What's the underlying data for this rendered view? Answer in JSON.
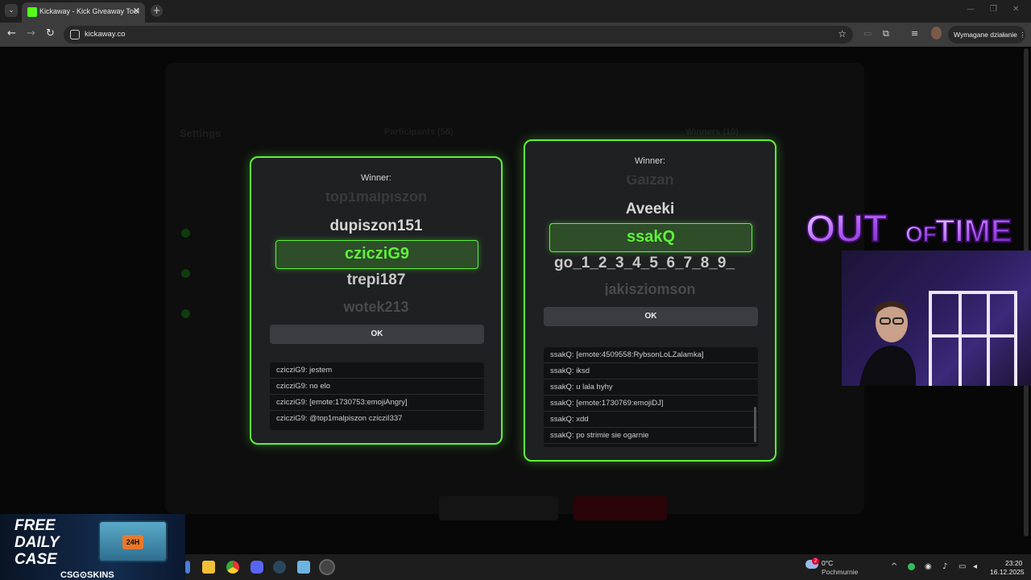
{
  "browser": {
    "tab_title": "Kickaway - Kick Giveaway Tool",
    "tab_menu_glyph": "⌄",
    "new_tab_glyph": "+",
    "url": "kickaway.co",
    "action_required_label": "Wymagane działanie",
    "accent_color": "#53fc18"
  },
  "modal_left": {
    "title": "Winner:",
    "reel": [
      "top1malpiszon",
      "dupiszon151",
      "trepi187",
      "wotek213"
    ],
    "winner": "czicziG9",
    "ok_label": "OK",
    "chat": [
      "czicziG9: jestem",
      "czicziG9: no elo",
      "czicziG9: [emote:1730753:emojiAngry]",
      "czicziG9: @top1malpiszon czicziI337"
    ]
  },
  "modal_right": {
    "title": "Winner:",
    "reel": [
      "Gaizan",
      "Aveeki",
      "go_1_2_3_4_5_6_7_8_9_",
      "jakisziomson"
    ],
    "winner": "ssakQ",
    "ok_label": "OK",
    "chat": [
      "ssakQ: [emote:4509558:RybsonLoLZalamka]",
      "ssakQ: iksd",
      "ssakQ: u lala hyhy",
      "ssakQ: [emote:1730769:emojiDJ]",
      "ssakQ: xdd",
      "ssakQ: po strimie sie ogarnie"
    ]
  },
  "background_page": {
    "settings_heading": "Settings",
    "participants_heading": "Participants (56)",
    "winners_heading": "Winners (10)"
  },
  "overlay": {
    "logo_text_a": "OUT",
    "logo_text_b": "OF",
    "logo_text_c": "TIME",
    "promo_line1": "FREE",
    "promo_line2": "DAILY",
    "promo_line3": "CASE",
    "promo_brand": "CSG⊙SKINS",
    "chest_label": "24H"
  },
  "taskbar": {
    "weather_temp": "0°C",
    "weather_desc": "Pochmurnie",
    "weather_badge": "2",
    "time": "23:20",
    "date": "16.12.2025"
  }
}
